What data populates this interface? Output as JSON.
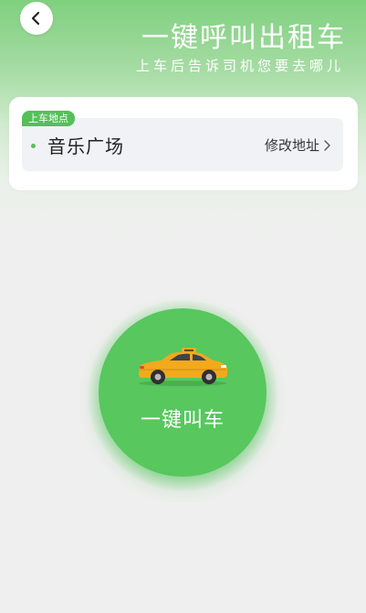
{
  "header": {
    "title": "一键呼叫出租车",
    "subtitle": "上车后告诉司机您要去哪儿"
  },
  "pickup": {
    "tag": "上车地点",
    "location": "音乐广场",
    "modify_label": "修改地址"
  },
  "call": {
    "label": "一键叫车"
  },
  "colors": {
    "accent": "#57c75e",
    "tag": "#54c05a",
    "taxi_body": "#f2a91e",
    "background": "#efefef"
  },
  "icons": {
    "back": "chevron-left-icon",
    "modify": "chevron-right-icon",
    "call": "taxi-icon",
    "location": "dot-icon"
  }
}
